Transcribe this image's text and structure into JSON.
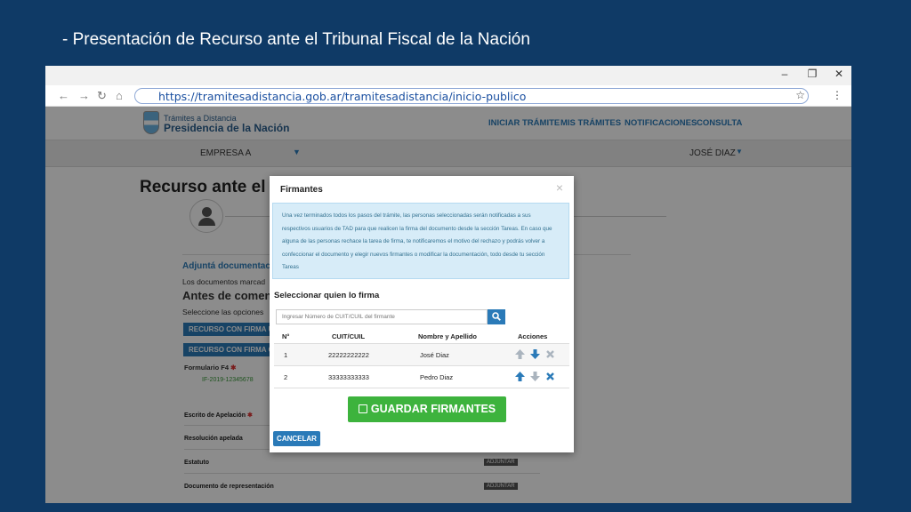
{
  "slide": {
    "title": "- Presentación de Recurso ante el Tribunal Fiscal de la Nación"
  },
  "browser": {
    "url": "https://tramitesadistancia.gob.ar/tramitesadistancia/inicio-publico",
    "controls": {
      "minimize": "–",
      "restore": "❐",
      "close": "✕"
    },
    "nav": {
      "back": "←",
      "forward": "→",
      "reload": "↻",
      "home": "⌂",
      "star": "☆",
      "menu": "⋮"
    }
  },
  "site": {
    "logo_line1": "Trámites a Distancia",
    "logo_line2": "Presidencia de la Nación",
    "nav": [
      "INICIAR TRÁMITE",
      "MIS TRÁMITES",
      "NOTIFICACIONES",
      "CONSULTA"
    ],
    "company": "EMPRESA A",
    "company_caret": "▼",
    "user": "JOSÉ DIAZ",
    "user_caret": "▼"
  },
  "background": {
    "page_title": "Recurso ante el T",
    "adjunta": "Adjuntá documentac",
    "docs_marcados": "Los documentos marcad",
    "antes": "Antes de comenza",
    "seleccione": "Seleccione las opciones",
    "btn1": "RECURSO CON FIRMA Ú",
    "btn2": "RECURSO CON FIRMA C",
    "formulario": "Formulario F4",
    "doc_ref": "IF-2019-12345678",
    "rows": [
      "Escrito de Apelación",
      "Resolución apelada",
      "Estatuto",
      "Documento de representación"
    ],
    "adjuntar": "ADJUNTAR",
    "required_mark": "✱"
  },
  "modal": {
    "title": "Firmantes",
    "close": "×",
    "info": "Una vez terminados todos los pasos del trámite, las personas seleccionadas serán notificadas a sus respectivos usuarios de TAD para que realicen la firma del documento desde la sección Tareas. En caso que alguna de las personas rechace la tarea de firma, te notificaremos el motivo del rechazo y podrás volver a confeccionar el documento y elegir nuevos firmantes o modificar la documentación, todo desde tu sección Tareas",
    "select_label": "Seleccionar quien lo firma",
    "search_placeholder": "Ingresar Número de CUIT/CUIL del firmante",
    "columns": [
      "N°",
      "CUIT/CUIL",
      "Nombre y Apellido",
      "Acciones"
    ],
    "rows": [
      {
        "n": "1",
        "cuit": "22222222222",
        "name": "José Diaz"
      },
      {
        "n": "2",
        "cuit": "33333333333",
        "name": "Pedro Diaz"
      }
    ],
    "save_label": "GUARDAR FIRMANTES",
    "cancel_label": "CANCELAR"
  },
  "colors": {
    "accent": "#2a7ab8",
    "save": "#3db33d",
    "slide_bg": "#0f3a66",
    "info_bg": "#d7ecf8"
  },
  "icons": [
    "search-icon",
    "arrow-up-icon",
    "arrow-down-icon",
    "remove-icon",
    "check-square-icon",
    "user-icon"
  ]
}
